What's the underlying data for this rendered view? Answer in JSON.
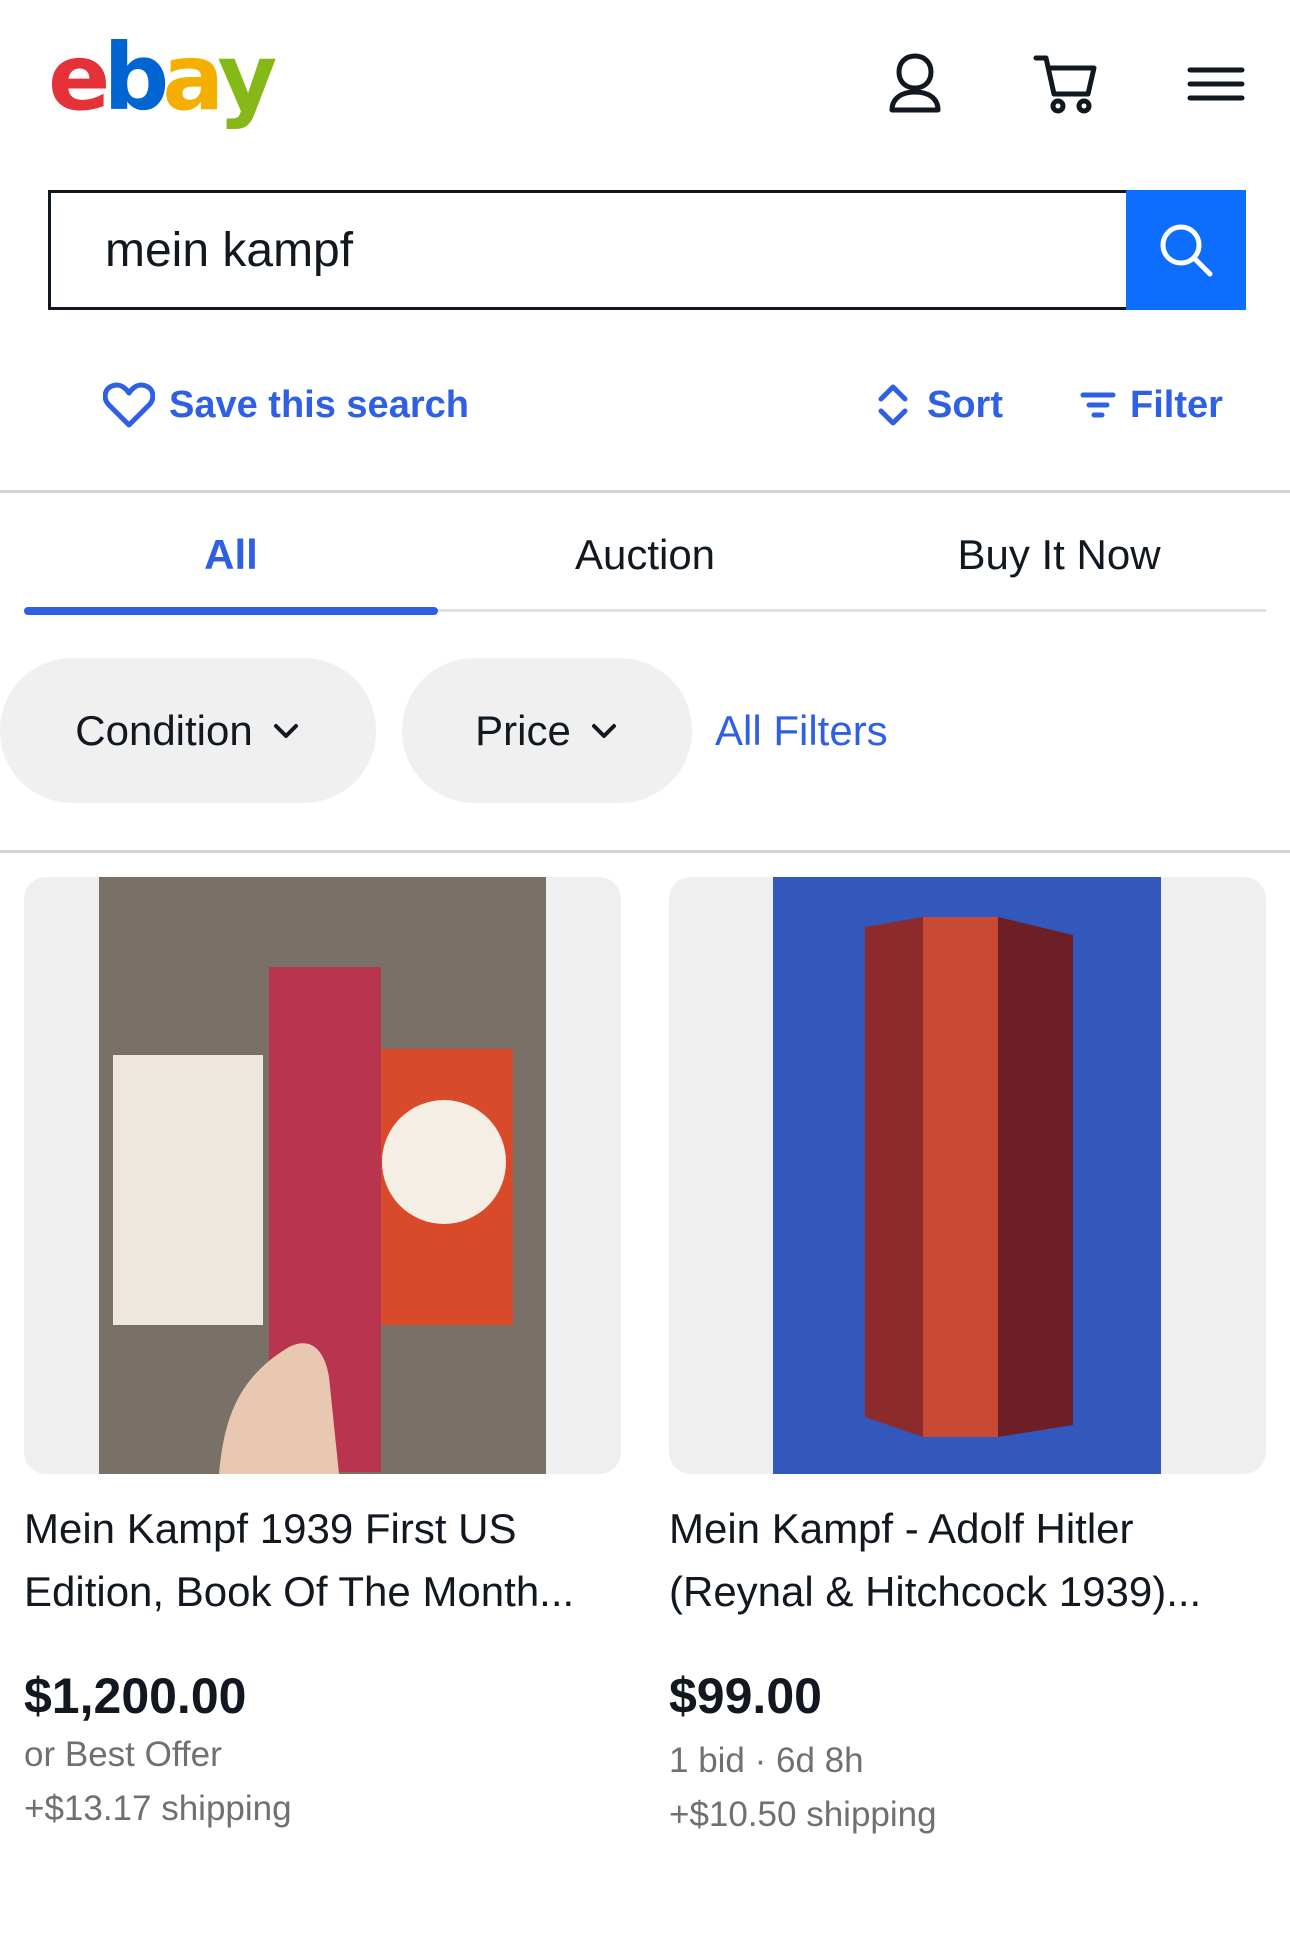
{
  "header": {
    "logo_letters": [
      "e",
      "b",
      "a",
      "y"
    ],
    "logo_colors": [
      "#e53238",
      "#0064d2",
      "#f5af02",
      "#86b817"
    ],
    "icons": [
      "account-icon",
      "cart-icon",
      "menu-icon"
    ]
  },
  "search": {
    "value": "mein kampf",
    "button_icon": "search-icon"
  },
  "actions": {
    "save_search": "Save this search",
    "sort": "Sort",
    "filter": "Filter"
  },
  "tabs": [
    {
      "label": "All",
      "active": true
    },
    {
      "label": "Auction",
      "active": false
    },
    {
      "label": "Buy It Now",
      "active": false
    }
  ],
  "filters": {
    "condition": "Condition",
    "price": "Price",
    "all_filters": "All Filters"
  },
  "listings": [
    {
      "title": "Mein Kampf 1939 First US Edition, Book Of The Month...",
      "price": "$1,200.00",
      "line1": "or Best Offer",
      "shipping": "+$13.17 shipping"
    },
    {
      "title": "Mein Kampf - Adolf Hitler (Reynal & Hitchcock 1939)...",
      "price": "$99.00",
      "line1": "1 bid · 6d 8h",
      "shipping": "+$10.50 shipping"
    }
  ],
  "colors": {
    "accent": "#2f5fe3",
    "search_button": "#0d6efd",
    "text": "#111820",
    "muted": "#707070"
  }
}
